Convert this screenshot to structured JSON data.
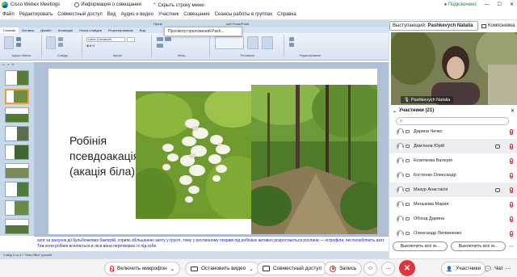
{
  "app": {
    "title": "Cisco Webex Meetings",
    "info_label": "Информация о совещании",
    "hide_menu_label": "Скрыть строку меню",
    "connected_label": "Подключено"
  },
  "menu": [
    "Файл",
    "Редактировать",
    "Совместный доступ",
    "Вид",
    "Аудио и видео",
    "Участник",
    "Совещание",
    "Сеансы работы в группах",
    "Справка"
  ],
  "ppt": {
    "tabs": [
      "Главная",
      "Вставка",
      "Дизайн",
      "Анимация",
      "Показ слайдов",
      "Рецензирование",
      "Вид"
    ],
    "font_name": "Calibri (Основной)",
    "ribbon_labels": [
      "Буфер обмена",
      "Слайды",
      "Шрифт",
      "Абзац",
      "Рисование",
      "Редактирование"
    ],
    "window_fragment": "Презе",
    "window_fragment2": "soft PowerPoint"
  },
  "tooltip": "Просмотр приложений Pash...",
  "slide": {
    "title": "Робінія псевдоакація (акація біла)"
  },
  "notes_text": "азот за рахунок дії бульбочкових бактерій, сприяє збільшенню азоту у ґрунті, тому у рослинному покриві під робінією активно розростаються рослини — нітрофіли, які полюбляють азот. Тож коли робінія вселяється в ліси вона перетворює їх під себе.",
  "status_text": "Слайд 11 из 17    \"Тема Office\"    русский",
  "speaker": {
    "label": "Выступающий:",
    "name": "Pashkevych Natalia",
    "layout_label": "Компоновка"
  },
  "video_name": "Pashkevych Natalia",
  "participants": {
    "header": "Участники (21)",
    "list": [
      {
        "name": "Дарина Чечко",
        "chat": false
      },
      {
        "name": "Дем'янов Юрій",
        "chat": true
      },
      {
        "name": "Козелкова Валерія",
        "chat": false
      },
      {
        "name": "Костенко Олександр",
        "chat": false
      },
      {
        "name": "Мазур Анастасія",
        "chat": true
      },
      {
        "name": "Менькова Мария",
        "chat": false
      },
      {
        "name": "Обіход Дарина",
        "chat": false
      },
      {
        "name": "Олександр Литвиненко",
        "chat": false
      }
    ],
    "mute_all": "Выключить все м...",
    "mute_all2": "Выключить все м..."
  },
  "bottom": {
    "mic": "Включить микрофон",
    "video": "Остановить видео",
    "share": "Совместный доступ",
    "record": "Запись",
    "participants": "Участники",
    "chat": "Чат"
  },
  "colors": {
    "accent": "#0b5cad",
    "end_call": "#e0333f",
    "muted": "#d9303e"
  }
}
